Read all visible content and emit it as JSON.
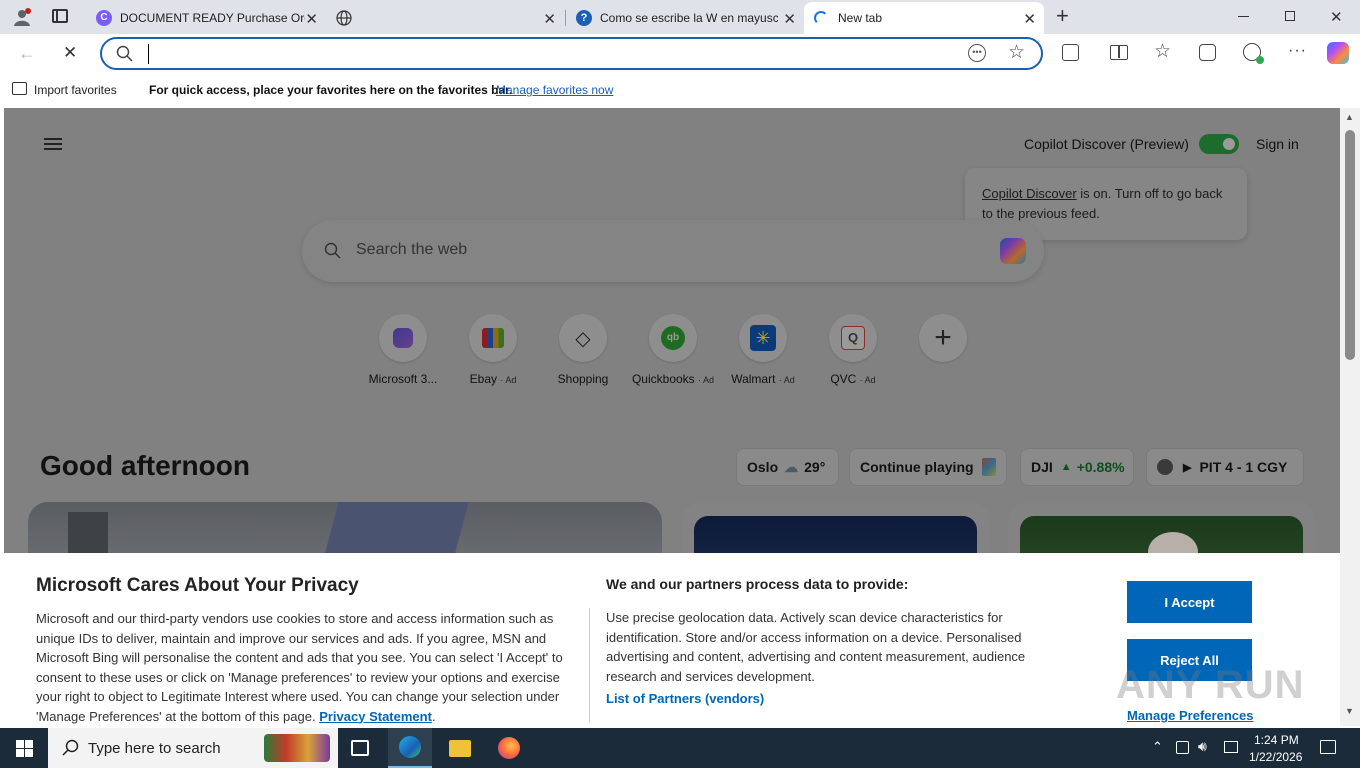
{
  "tabs": [
    {
      "title": "DOCUMENT READY Purchase Order"
    },
    {
      "title": ""
    },
    {
      "title": "Como se escribe la W en mayusculas"
    },
    {
      "title": "New tab"
    }
  ],
  "toolbar": {
    "address_value": ""
  },
  "favorites_bar": {
    "import_label": "Import favorites",
    "hint": "For quick access, place your favorites here on the favorites bar.",
    "manage_link": "Manage favorites now"
  },
  "newtab": {
    "copilot_discover_label": "Copilot Discover (Preview)",
    "sign_in": "Sign in",
    "tooltip_link": "Copilot Discover",
    "tooltip_rest": " is on. Turn off to go back to the previous feed.",
    "search_placeholder": "Search the web",
    "shortcuts": [
      {
        "label": "Microsoft 3...",
        "ad": ""
      },
      {
        "label": "Ebay",
        "ad": "· Ad"
      },
      {
        "label": "Shopping",
        "ad": ""
      },
      {
        "label": "Quickbooks",
        "ad": "· Ad"
      },
      {
        "label": "Walmart",
        "ad": "· Ad"
      },
      {
        "label": "QVC",
        "ad": "· Ad"
      }
    ],
    "greeting": "Good afternoon",
    "weather": {
      "city": "Oslo",
      "temp": "29°"
    },
    "continue_playing": "Continue playing",
    "stock": {
      "symbol": "DJI",
      "change": "+0.88%"
    },
    "score": {
      "text": "PIT  4 - 1  CGY"
    }
  },
  "privacy": {
    "title": "Microsoft Cares About Your Privacy",
    "body": "Microsoft and our third-party vendors use cookies to store and access information such as unique IDs to deliver, maintain and improve our services and ads. If you agree, MSN and Microsoft Bing will personalise the content and ads that you see. You can select 'I Accept' to consent to these uses or click on 'Manage preferences' to review your options and exercise your right to object to Legitimate Interest where used.  You can change your selection under 'Manage Preferences' at the bottom of this page. ",
    "privacy_link": "Privacy Statement",
    "partners_title": "We and our partners process data to provide:",
    "partners_body": "Use precise geolocation data. Actively scan device characteristics for identification. Store and/or access information on a device. Personalised advertising and content, advertising and content measurement, audience research and services development.",
    "partners_link": "List of Partners (vendors)",
    "accept": "I Accept",
    "reject": "Reject All",
    "manage": "Manage Preferences"
  },
  "taskbar": {
    "search_placeholder": "Type here to search",
    "time": "1:24 PM",
    "date": "1/22/2026"
  },
  "watermark": "ANY RUN"
}
